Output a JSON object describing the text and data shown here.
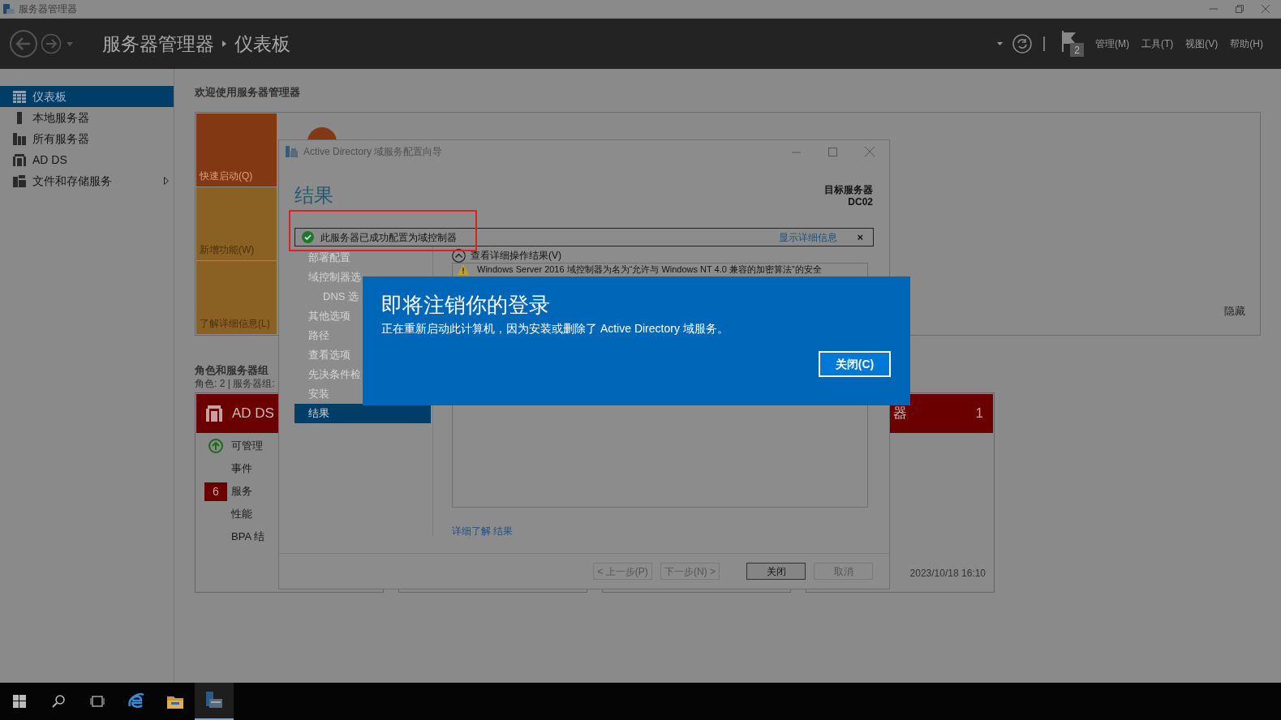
{
  "window": {
    "title": "服务器管理器"
  },
  "header": {
    "breadcrumb": [
      "服务器管理器",
      "仪表板"
    ],
    "notification_count": "2",
    "menus": [
      "管理(M)",
      "工具(T)",
      "视图(V)",
      "帮助(H)"
    ]
  },
  "sidebar": {
    "items": [
      {
        "label": "仪表板",
        "kind": "dashboard",
        "selected": true,
        "has_submenu": false
      },
      {
        "label": "本地服务器",
        "kind": "server",
        "selected": false,
        "has_submenu": false
      },
      {
        "label": "所有服务器",
        "kind": "servers",
        "selected": false,
        "has_submenu": false
      },
      {
        "label": "AD DS",
        "kind": "adds",
        "selected": false,
        "has_submenu": false
      },
      {
        "label": "文件和存储服务",
        "kind": "files",
        "selected": false,
        "has_submenu": true
      }
    ]
  },
  "welcome": {
    "title": "欢迎使用服务器管理器",
    "tiles": [
      {
        "label": "快速启动(Q)",
        "color": "#833814"
      },
      {
        "label": "新增功能(W)",
        "color": "#8b6123"
      },
      {
        "label": "了解详细信息(L)",
        "color": "#8b6123"
      }
    ],
    "hide_link": "隐藏"
  },
  "roles": {
    "title": "角色和服务器组",
    "summary": "角色: 2 | 服务器组:",
    "cards": [
      {
        "kind": "role",
        "title": "AD DS",
        "rows": [
          {
            "kind": "status",
            "label": "可管理"
          },
          {
            "kind": "plain",
            "label": "事件"
          },
          {
            "kind": "count",
            "label": "服务",
            "count": "6"
          },
          {
            "kind": "plain",
            "label": "性能"
          },
          {
            "kind": "plain",
            "label": "BPA 结"
          }
        ]
      },
      {
        "kind": "covered"
      },
      {
        "kind": "covered"
      },
      {
        "kind": "role",
        "title": "器",
        "count": "1",
        "timestamp": "2023/10/18 16:10"
      }
    ]
  },
  "wizard": {
    "title": "Active Directory 域服务配置向导",
    "heading": "结果",
    "target_label": "目标服务器",
    "target_server": "DC02",
    "notice": {
      "text": "此服务器已成功配置为域控制器",
      "link": "显示详细信息",
      "close": "×"
    },
    "steps": [
      {
        "label": "部署配置",
        "selected": false
      },
      {
        "label": "域控制器选",
        "selected": false,
        "children": [
          {
            "label": "DNS 选",
            "selected": false
          }
        ]
      },
      {
        "label": "其他选项",
        "selected": false
      },
      {
        "label": "路径",
        "selected": false
      },
      {
        "label": "查看选项",
        "selected": false
      },
      {
        "label": "先决条件检",
        "selected": false
      },
      {
        "label": "安装",
        "selected": false
      },
      {
        "label": "结果",
        "selected": true
      }
    ],
    "details_toggle": "查看详细操作结果(V)",
    "details": [
      {
        "kind": "warning",
        "text": "Windows Server 2016 域控制器为名为“允许与 Windows NT 4.0 兼容的加密算法”的安全"
      }
    ],
    "learn_more": "详细了解 结果",
    "buttons": [
      {
        "label": "< 上一步(P)",
        "default": false
      },
      {
        "label": "下一步(N) >",
        "default": false
      },
      {
        "label": "关闭",
        "default": true
      },
      {
        "label": "取消",
        "default": false
      }
    ]
  },
  "signout_dialog": {
    "title": "即将注销你的登录",
    "message": "正在重新启动此计算机，因为安装或删除了 Active Directory 域服务。",
    "button": "关闭(C)"
  },
  "taskbar": {
    "apps": [
      {
        "kind": "start",
        "active": false
      },
      {
        "kind": "search",
        "active": false
      },
      {
        "kind": "taskview",
        "active": false
      },
      {
        "kind": "browser",
        "active": false
      },
      {
        "kind": "folder",
        "active": false
      },
      {
        "kind": "servermanager",
        "active": true
      }
    ]
  }
}
